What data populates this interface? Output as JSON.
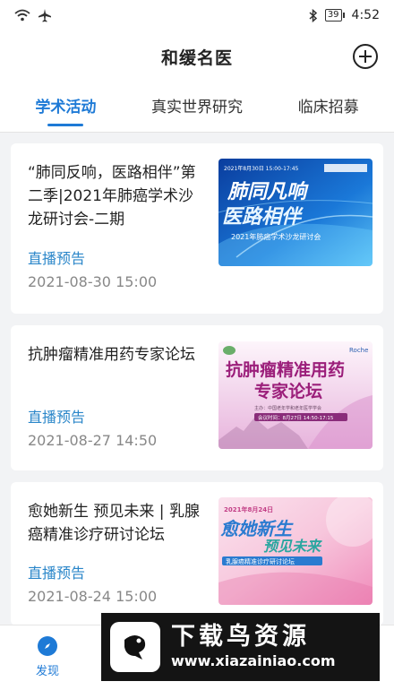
{
  "status_bar": {
    "time": "4:52",
    "battery": "39"
  },
  "header": {
    "title": "和缓名医"
  },
  "tabs": [
    {
      "label": "学术活动"
    },
    {
      "label": "真实世界研究"
    },
    {
      "label": "临床招募"
    }
  ],
  "cards": [
    {
      "title": "“肺同反响，医路相伴”第二季|2021年肺癌学术沙龙研讨会-二期",
      "status": "直播预告",
      "date": "2021-08-30 15:00",
      "thumb": {
        "headline": "肺同凡响",
        "headline2": "医路相伴",
        "date_line": "2021年8月30日 15:00-17:45",
        "caption": "2021年肺癌学术沙龙研讨会"
      }
    },
    {
      "title": "抗肿瘤精准用药专家论坛",
      "status": "直播预告",
      "date": "2021-08-27 14:50",
      "thumb": {
        "brand": "Roche",
        "headline": "抗肿瘤精准用药",
        "headline2": "专家论坛",
        "host_line": "主办：中国老年学和老年医学学会",
        "time_line": "会议时间：8月27日 14:50-17:15"
      }
    },
    {
      "title": "愈她新生 预见未来 | 乳腺癌精准诊疗研讨论坛",
      "status": "直播预告",
      "date": "2021-08-24 15:00",
      "thumb": {
        "date_line": "2021年8月24日",
        "headline": "愈她新生",
        "headline2": "预见未来",
        "caption": "乳腺癌精准诊疗研讨论坛"
      }
    }
  ],
  "bottom_nav": {
    "discover_label": "发现"
  },
  "watermark": {
    "title": "下载鸟资源",
    "url": "www.xiazainiao.com"
  },
  "colors": {
    "accent": "#1e7ad6",
    "status_link": "#2a86c9",
    "date_gray": "#888888"
  }
}
